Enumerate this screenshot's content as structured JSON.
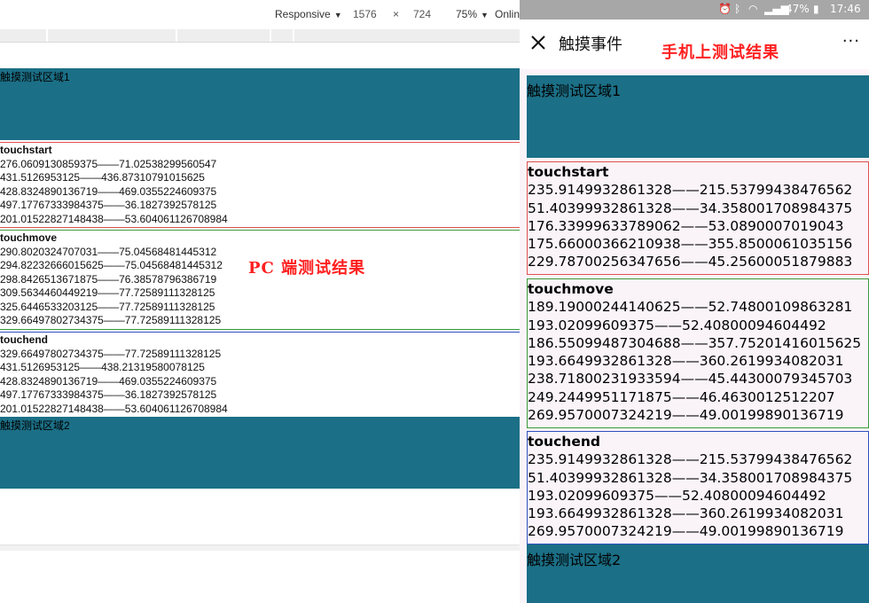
{
  "devtools": {
    "device_mode": "Responsive",
    "width": "1576",
    "times": "×",
    "height": "724",
    "zoom": "75%",
    "network": "Onlin"
  },
  "pc": {
    "zone1_label": "触摸测试区域1",
    "zone2_label": "触摸测试区域2",
    "annotation": "PC 端测试结果",
    "logs": [
      {
        "title": "touchstart",
        "border_color": "#e05050",
        "lines": [
          "276.0609130859375——71.02538299560547",
          "431.5126953125——436.87310791015625",
          "428.8324890136719——469.0355224609375",
          "497.17767333984375——36.1827392578125",
          "201.01522827148438——53.604061126708984"
        ]
      },
      {
        "title": "touchmove",
        "border_color": "#3a9a3a",
        "lines": [
          "290.8020324707031——75.04568481445312",
          "294.82232666015625——75.04568481445312",
          "298.8426513671875——76.38578796386719",
          "309.5634460449219——77.72589111328125",
          "325.6446533203125——77.72589111328125",
          "329.66497802734375——77.72589111328125"
        ]
      },
      {
        "title": "touchend",
        "border_color": "#3050c0",
        "lines": [
          "329.66497802734375——77.72589111328125",
          "431.5126953125——438.21319580078125",
          "428.8324890136719——469.0355224609375",
          "497.17767333984375——36.1827392578125",
          "201.01522827148438——53.604061126708984"
        ]
      }
    ]
  },
  "mobile": {
    "status_battery": "47%",
    "status_time": "17:46",
    "nav_title": "触摸事件",
    "annotation": "手机上测试结果",
    "more": "···",
    "zone1_label": "触摸测试区域1",
    "zone2_label": "触摸测试区域2",
    "logs": [
      {
        "title": "touchstart",
        "border_color": "#e05050",
        "lines": [
          "235.9149932861328——215.53799438476562",
          "51.40399932861328——34.358001708984375",
          "176.33999633789062——53.0890007019043",
          "175.66000366210938——355.8500061035156",
          "229.78700256347656——45.25600051879883"
        ]
      },
      {
        "title": "touchmove",
        "border_color": "#3a9a3a",
        "lines": [
          "189.19000244140625——52.74800109863281",
          "193.02099609375——52.40800094604492",
          "186.55099487304688——357.75201416015625",
          "193.6649932861328——360.2619934082031",
          "238.71800231933594——45.44300079345703",
          "249.2449951171875——46.4630012512207",
          "269.9570007324219——49.00199890136719"
        ]
      },
      {
        "title": "touchend",
        "border_color": "#3050c0",
        "lines": [
          "235.9149932861328——215.53799438476562",
          "51.40399932861328——34.358001708984375",
          "193.02099609375——52.40800094604492",
          "193.6649932861328——360.2619934082031",
          "269.9570007324219——49.00199890136719"
        ]
      }
    ]
  }
}
